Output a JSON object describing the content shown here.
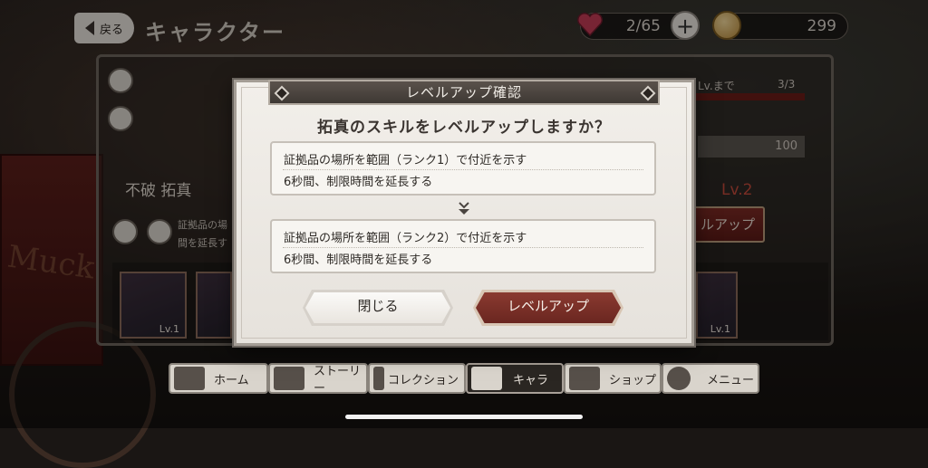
{
  "header": {
    "back_label": "戻る",
    "title": "キャラクター",
    "stamina": "2/65",
    "coins": "299",
    "plus_label": "+"
  },
  "background_panel": {
    "character_name": "不破 拓真",
    "skill_snippet_line1": "証拠品の場",
    "skill_snippet_line2": "間を延長す",
    "level_until": "Lv.まで",
    "level_progress": "3/3",
    "level_progress_fraction": 1.0,
    "count_value": "100",
    "next_level": "Lv.2",
    "levelup_partial": "ルアップ",
    "card_levels": [
      "Lv.1",
      "Lv.1"
    ],
    "cart_text": "Muck"
  },
  "modal": {
    "title": "レベルアップ確認",
    "question": "拓真のスキルをレベルアップしますか？",
    "current_skill": {
      "line1": "証拠品の場所を範囲（ランク1）で付近を示す",
      "line2": "6秒間、制限時間を延長する"
    },
    "next_skill": {
      "line1": "証拠品の場所を範囲（ランク2）で付近を示す",
      "line2": "6秒間、制限時間を延長する"
    },
    "close_label": "閉じる",
    "levelup_label": "レベルアップ"
  },
  "nav": {
    "items": [
      {
        "label": "ホーム",
        "icon": "house-icon"
      },
      {
        "label": "ストーリー",
        "icon": "book-icon"
      },
      {
        "label": "コレクション",
        "icon": "collection-icon"
      },
      {
        "label": "キャラ",
        "icon": "character-icon"
      },
      {
        "label": "ショップ",
        "icon": "shop-icon"
      },
      {
        "label": "メニュー",
        "icon": "gear-icon"
      }
    ],
    "active": "キャラ"
  },
  "colors": {
    "accent_red": "#7a2e26",
    "level_red": "#c24a3a",
    "modal_bg": "#f2efea",
    "title_bar": "#4a433e"
  }
}
